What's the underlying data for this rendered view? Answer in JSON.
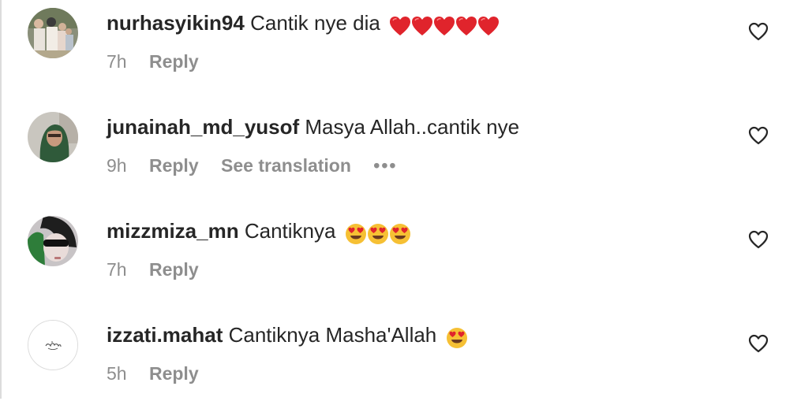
{
  "comments": [
    {
      "username": "nurhasyikin94",
      "text": "Cantik nye dia",
      "emoji_icons": [
        "red-heart-icon",
        "red-heart-icon",
        "red-heart-icon",
        "red-heart-icon",
        "red-heart-icon"
      ],
      "time": "7h",
      "reply_label": "Reply"
    },
    {
      "username": "junainah_md_yusof",
      "text": "Masya Allah..cantik nye",
      "time": "9h",
      "reply_label": "Reply",
      "translation_label": "See translation",
      "more_label": "•••"
    },
    {
      "username": "mizzmiza_mn",
      "text": "Cantiknya",
      "emoji_icons": [
        "heart-eyes-face-icon",
        "heart-eyes-face-icon",
        "heart-eyes-face-icon"
      ],
      "time": "7h",
      "reply_label": "Reply"
    },
    {
      "username": "izzati.mahat",
      "text": "Cantiknya Masha'Allah",
      "emoji_icons": [
        "heart-eyes-face-icon"
      ],
      "time": "5h",
      "reply_label": "Reply"
    }
  ],
  "colors": {
    "text_primary": "#262626",
    "text_secondary": "#8e8e8e",
    "emoji_red": "#e0242c",
    "emoji_yellow": "#f6c034"
  },
  "icons": {
    "like": "heart-outline-icon",
    "more": "ellipsis-icon"
  }
}
